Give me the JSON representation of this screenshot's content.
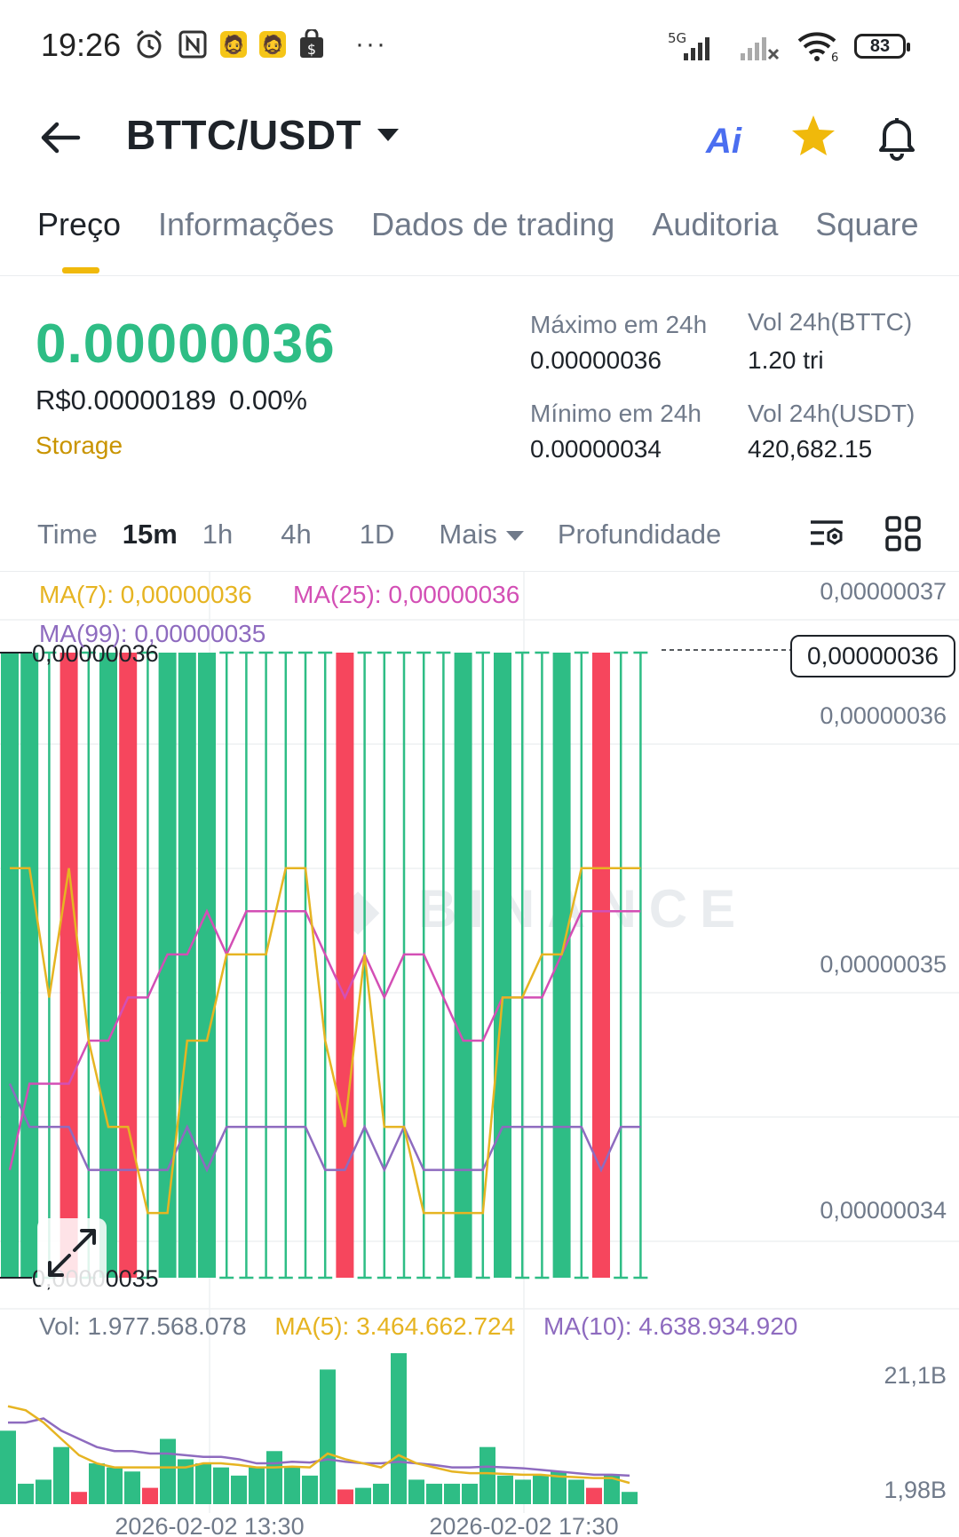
{
  "status_bar": {
    "time": "19:26",
    "network_label": "5G",
    "battery": "83",
    "wifi_sub": "6",
    "more": "···"
  },
  "header": {
    "pair": "BTTC/USDT",
    "ai_label": "Ai"
  },
  "tabs": [
    {
      "label": "Preço",
      "active": true
    },
    {
      "label": "Informações",
      "active": false
    },
    {
      "label": "Dados de trading",
      "active": false
    },
    {
      "label": "Auditoria",
      "active": false
    },
    {
      "label": "Square",
      "active": false
    }
  ],
  "ticker": {
    "price": "0.00000036",
    "brl_price": "R$0.00000189",
    "change_pct": "0.00%",
    "tag": "Storage",
    "high_label": "Máximo em 24h",
    "high_value": "0.00000036",
    "low_label": "Mínimo em 24h",
    "low_value": "0.00000034",
    "vol_base_label": "Vol 24h(BTTC)",
    "vol_base_value": "1.20 tri",
    "vol_quote_label": "Vol 24h(USDT)",
    "vol_quote_value": "420,682.15"
  },
  "intervals": {
    "items": [
      "Time",
      "15m",
      "1h",
      "4h",
      "1D"
    ],
    "active": "15m",
    "more": "Mais",
    "depth": "Profundidade"
  },
  "colors": {
    "up": "#2ebd85",
    "down": "#f6465d",
    "ma7": "#e6b422",
    "ma25": "#d34fb5",
    "ma99": "#8e6bbf",
    "accent": "#f0b90b"
  },
  "chart_legend": {
    "ma7": "MA(7): 0,00000036",
    "ma25": "MA(25): 0,00000036",
    "ma99": "MA(99): 0,00000035"
  },
  "chart_data": [
    {
      "type": "candlestick",
      "interval": "15m",
      "y_axis_ticks": [
        "0,00000037",
        "0,00000036",
        "0,00000035",
        "0,00000034"
      ],
      "current_price_label": "0,00000036",
      "high_marker": "0,00000036",
      "low_marker": "0,00000035",
      "ylim": [
        3.4e-07,
        3.7e-07
      ],
      "candles": [
        {
          "open": 3.5e-07,
          "close": 3.6e-07,
          "dir": "up"
        },
        {
          "open": 3.5e-07,
          "close": 3.6e-07,
          "dir": "up"
        },
        {
          "open": 3.6e-07,
          "close": 3.5e-07,
          "dir": "up",
          "thin": true
        },
        {
          "open": 3.6e-07,
          "close": 3.5e-07,
          "dir": "down"
        },
        {
          "open": 3.6e-07,
          "close": 3.5e-07,
          "dir": "up",
          "thin": true
        },
        {
          "open": 3.5e-07,
          "close": 3.6e-07,
          "dir": "up"
        },
        {
          "open": 3.6e-07,
          "close": 3.5e-07,
          "dir": "down"
        },
        {
          "open": 3.6e-07,
          "close": 3.5e-07,
          "dir": "up",
          "thin": true
        },
        {
          "open": 3.5e-07,
          "close": 3.6e-07,
          "dir": "up"
        },
        {
          "open": 3.5e-07,
          "close": 3.6e-07,
          "dir": "up"
        },
        {
          "open": 3.5e-07,
          "close": 3.6e-07,
          "dir": "up"
        },
        {
          "open": 3.6e-07,
          "close": 3.5e-07,
          "dir": "up",
          "thin": true
        },
        {
          "open": 3.6e-07,
          "close": 3.5e-07,
          "dir": "up",
          "thin": true
        },
        {
          "open": 3.6e-07,
          "close": 3.5e-07,
          "dir": "up",
          "thin": true
        },
        {
          "open": 3.6e-07,
          "close": 3.5e-07,
          "dir": "up",
          "thin": true
        },
        {
          "open": 3.6e-07,
          "close": 3.5e-07,
          "dir": "up",
          "thin": true
        },
        {
          "open": 3.6e-07,
          "close": 3.5e-07,
          "dir": "up",
          "thin": true
        },
        {
          "open": 3.6e-07,
          "close": 3.5e-07,
          "dir": "down"
        },
        {
          "open": 3.6e-07,
          "close": 3.5e-07,
          "dir": "up",
          "thin": true
        },
        {
          "open": 3.6e-07,
          "close": 3.5e-07,
          "dir": "up",
          "thin": true
        },
        {
          "open": 3.6e-07,
          "close": 3.5e-07,
          "dir": "up",
          "thin": true
        },
        {
          "open": 3.6e-07,
          "close": 3.5e-07,
          "dir": "up",
          "thin": true
        },
        {
          "open": 3.6e-07,
          "close": 3.5e-07,
          "dir": "up",
          "thin": true
        },
        {
          "open": 3.5e-07,
          "close": 3.6e-07,
          "dir": "up"
        },
        {
          "open": 3.6e-07,
          "close": 3.5e-07,
          "dir": "up",
          "thin": true
        },
        {
          "open": 3.5e-07,
          "close": 3.6e-07,
          "dir": "up"
        },
        {
          "open": 3.6e-07,
          "close": 3.5e-07,
          "dir": "up",
          "thin": true
        },
        {
          "open": 3.6e-07,
          "close": 3.5e-07,
          "dir": "up",
          "thin": true
        },
        {
          "open": 3.5e-07,
          "close": 3.6e-07,
          "dir": "up"
        },
        {
          "open": 3.6e-07,
          "close": 3.5e-07,
          "dir": "up",
          "thin": true
        },
        {
          "open": 3.6e-07,
          "close": 3.5e-07,
          "dir": "down"
        },
        {
          "open": 3.6e-07,
          "close": 3.5e-07,
          "dir": "up",
          "thin": true
        },
        {
          "open": 3.6e-07,
          "close": 3.5e-07,
          "dir": "up",
          "thin": true
        }
      ],
      "ma7": [
        3.58e-07,
        3.58e-07,
        3.55e-07,
        3.58e-07,
        3.54e-07,
        3.52e-07,
        3.52e-07,
        3.5e-07,
        3.5e-07,
        3.54e-07,
        3.54e-07,
        3.56e-07,
        3.56e-07,
        3.56e-07,
        3.58e-07,
        3.58e-07,
        3.54e-07,
        3.52e-07,
        3.56e-07,
        3.52e-07,
        3.52e-07,
        3.5e-07,
        3.5e-07,
        3.5e-07,
        3.5e-07,
        3.55e-07,
        3.55e-07,
        3.56e-07,
        3.56e-07,
        3.58e-07,
        3.58e-07,
        3.58e-07,
        3.58e-07
      ],
      "ma25": [
        3.51e-07,
        3.53e-07,
        3.53e-07,
        3.53e-07,
        3.54e-07,
        3.54e-07,
        3.55e-07,
        3.55e-07,
        3.56e-07,
        3.56e-07,
        3.57e-07,
        3.56e-07,
        3.57e-07,
        3.57e-07,
        3.57e-07,
        3.57e-07,
        3.56e-07,
        3.55e-07,
        3.56e-07,
        3.55e-07,
        3.56e-07,
        3.56e-07,
        3.55e-07,
        3.54e-07,
        3.54e-07,
        3.55e-07,
        3.55e-07,
        3.55e-07,
        3.56e-07,
        3.57e-07,
        3.57e-07,
        3.57e-07,
        3.57e-07
      ],
      "ma99": [
        3.53e-07,
        3.52e-07,
        3.52e-07,
        3.52e-07,
        3.51e-07,
        3.51e-07,
        3.51e-07,
        3.51e-07,
        3.51e-07,
        3.52e-07,
        3.51e-07,
        3.52e-07,
        3.52e-07,
        3.52e-07,
        3.52e-07,
        3.52e-07,
        3.51e-07,
        3.51e-07,
        3.52e-07,
        3.51e-07,
        3.52e-07,
        3.51e-07,
        3.51e-07,
        3.51e-07,
        3.51e-07,
        3.52e-07,
        3.52e-07,
        3.52e-07,
        3.52e-07,
        3.52e-07,
        3.51e-07,
        3.52e-07,
        3.52e-07
      ]
    },
    {
      "type": "bar",
      "title": "Vol",
      "y_axis_ticks": [
        "21,1B",
        "1,98B"
      ],
      "x_axis_ticks": [
        "2026-02-02 13:30",
        "2026-02-02 17:30"
      ],
      "values": [
        9.0,
        2.5,
        3.0,
        7.0,
        1.5,
        5.0,
        4.5,
        4.0,
        2.0,
        8.0,
        5.5,
        5.0,
        4.5,
        3.5,
        4.5,
        6.5,
        4.5,
        3.5,
        16.5,
        1.8,
        2.0,
        2.5,
        18.5,
        3.0,
        2.5,
        2.5,
        2.5,
        7.0,
        3.5,
        3.0,
        3.5,
        4.0,
        3.0,
        2.0,
        3.5,
        1.5
      ],
      "directions": [
        "up",
        "up",
        "up",
        "up",
        "down",
        "up",
        "up",
        "up",
        "down",
        "up",
        "up",
        "up",
        "up",
        "up",
        "up",
        "up",
        "up",
        "up",
        "up",
        "down",
        "up",
        "up",
        "up",
        "up",
        "up",
        "up",
        "up",
        "up",
        "up",
        "up",
        "up",
        "up",
        "up",
        "down",
        "up",
        "up"
      ],
      "legend": {
        "vol": "Vol: 1.977.568.078",
        "ma5": "MA(5): 3.464.662.724",
        "ma10": "MA(10): 4.638.934.920"
      }
    }
  ]
}
